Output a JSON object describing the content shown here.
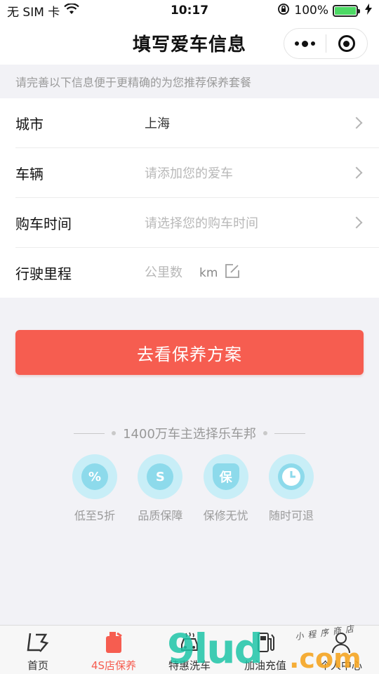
{
  "status_bar": {
    "carrier": "无 SIM 卡",
    "time": "10:17",
    "battery_percent": "100%",
    "battery_level": 1.0,
    "icons": [
      "wifi-icon",
      "orientation-lock-icon",
      "battery-icon",
      "charging-icon"
    ]
  },
  "nav": {
    "title": "填写爱车信息",
    "capsule_icons": [
      "more-dots-icon",
      "close-target-icon"
    ]
  },
  "hint": "请完善以下信息便于更精确的为您推荐保养套餐",
  "form": {
    "city": {
      "label": "城市",
      "value": "上海"
    },
    "vehicle": {
      "label": "车辆",
      "placeholder": "请添加您的爱车"
    },
    "purchase_time": {
      "label": "购车时间",
      "placeholder": "请选择您的购车时间"
    },
    "mileage": {
      "label": "行驶里程",
      "placeholder": "公里数",
      "unit": "km"
    }
  },
  "cta": {
    "label": "去看保养方案"
  },
  "promo": {
    "text": "1400万车主选择乐车邦"
  },
  "features": [
    {
      "label": "低至5折",
      "icon": "percent-icon",
      "glyph": "%"
    },
    {
      "label": "品质保障",
      "icon": "quality-s-icon",
      "glyph": "S"
    },
    {
      "label": "保修无忧",
      "icon": "warranty-shield-icon",
      "glyph": "保"
    },
    {
      "label": "随时可退",
      "icon": "clock-icon",
      "glyph": ""
    }
  ],
  "tabs": [
    {
      "label": "首页",
      "icon": "home-logo-icon",
      "active": false
    },
    {
      "label": "4S店保养",
      "icon": "oil-can-icon",
      "active": true
    },
    {
      "label": "特惠洗车",
      "icon": "car-wash-icon",
      "active": false
    },
    {
      "label": "加油充值",
      "icon": "fuel-pump-icon",
      "active": false
    },
    {
      "label": "个人中心",
      "icon": "user-icon",
      "active": false
    }
  ],
  "watermark": {
    "main": "9lud",
    "suffix": ".com",
    "script": "小程序商店"
  },
  "colors": {
    "accent": "#f65d50",
    "feature_bg": "#c8eef7",
    "feature_fg": "#8ddaeb",
    "watermark_green": "#1ec5a8",
    "watermark_orange": "#f5a623"
  }
}
